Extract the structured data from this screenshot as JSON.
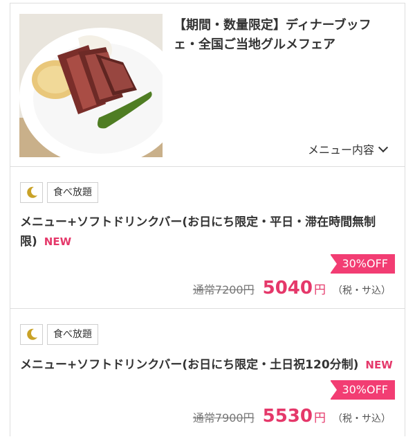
{
  "header": {
    "title": "【期間・数量限定】ディナーブッフェ・全国ご当地グルメフェア",
    "menu_toggle": "メニュー内容"
  },
  "plans": [
    {
      "tag": "食べ放題",
      "name": "メニュー+ソフトドリンクバー(お日にち限定・平日・滞在時間無制限)",
      "new_badge": "NEW",
      "discount": "30%OFF",
      "regular_price": "通常7200円",
      "price": "5040",
      "currency": "円",
      "tax_note": "（税・サ込）"
    },
    {
      "tag": "食べ放題",
      "name": "メニュー+ソフトドリンクバー(お日にち限定・土日祝120分制)",
      "new_badge": "NEW",
      "discount": "30%OFF",
      "regular_price": "通常7900円",
      "price": "5530",
      "currency": "円",
      "tax_note": "（税・サ込）"
    }
  ],
  "icons": {
    "moon": "moon-icon",
    "chevron": "chevron-down-icon"
  },
  "colors": {
    "accent": "#e5386a",
    "discount_bg": "#f23d73",
    "moon": "#c9a227"
  }
}
